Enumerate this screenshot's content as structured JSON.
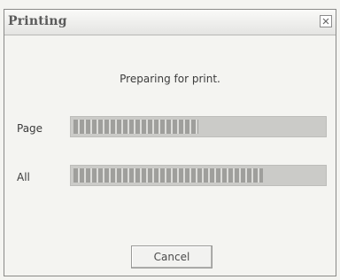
{
  "window": {
    "title": "Printing",
    "close_icon": "close-icon"
  },
  "message": "Preparing for print.",
  "progress": [
    {
      "label": "Page",
      "fraction": 0.5
    },
    {
      "label": "All",
      "fraction": 0.76
    }
  ],
  "buttons": {
    "cancel_label": "Cancel"
  },
  "colors": {
    "background": "#f4f4f1",
    "bar_track": "#cbcbc8",
    "bar_fill": "#9f9f9c"
  }
}
